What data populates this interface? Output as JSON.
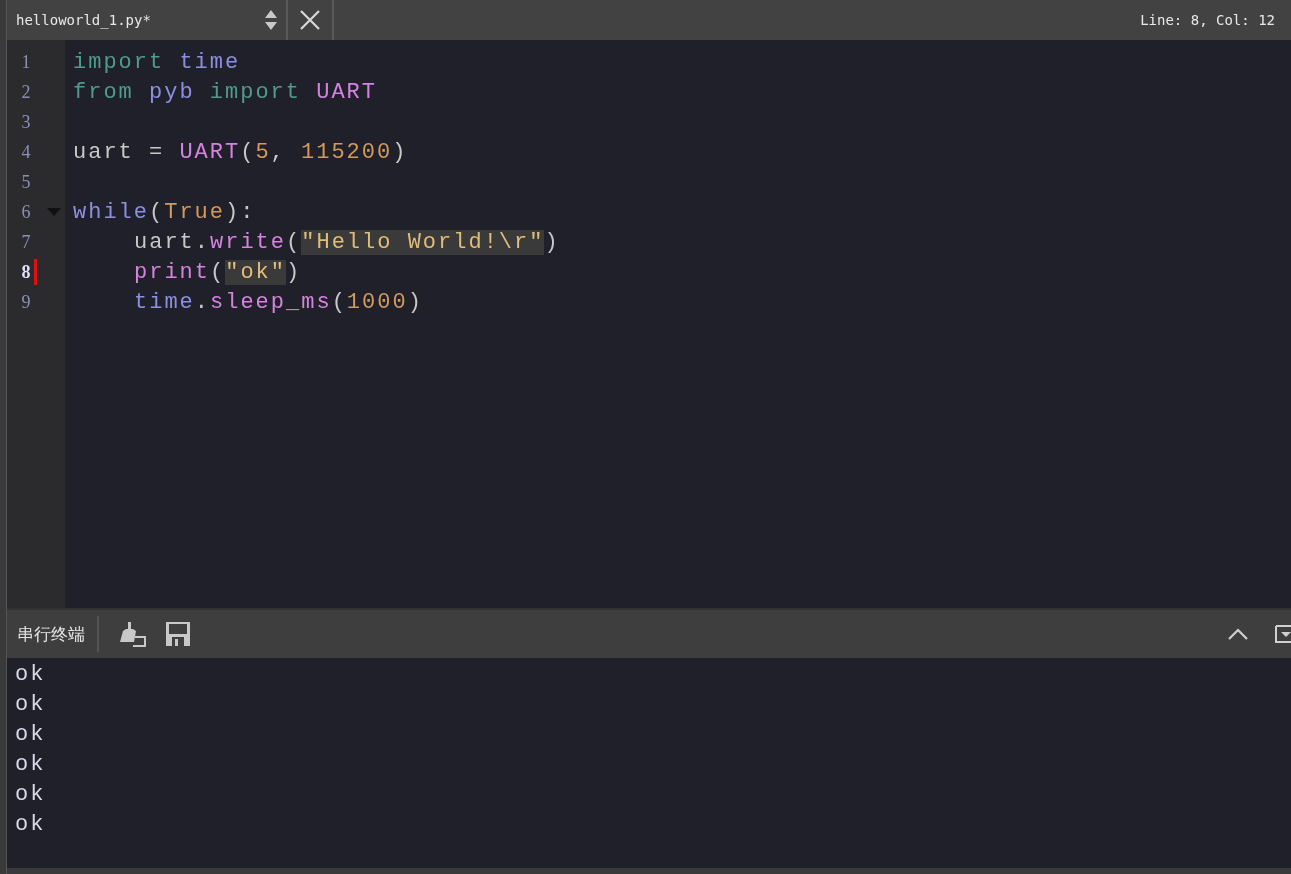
{
  "tab": {
    "filename": "helloworld_1.py*"
  },
  "status": "Line: 8, Col: 12",
  "editor": {
    "lines": [
      {
        "number": "1",
        "current": false,
        "changed": false,
        "fold": false,
        "tokens": [
          {
            "kind": "keyword",
            "text": "import",
            "gap": false
          },
          {
            "kind": "name",
            "text": "time",
            "gap": true
          }
        ]
      },
      {
        "number": "2",
        "current": false,
        "changed": false,
        "fold": false,
        "tokens": [
          {
            "kind": "keyword",
            "text": "from",
            "gap": false
          },
          {
            "kind": "name",
            "text": "pyb",
            "gap": true
          },
          {
            "kind": "keyword",
            "text": "import",
            "gap": true
          },
          {
            "kind": "call",
            "text": "UART",
            "gap": true
          }
        ]
      },
      {
        "number": "3",
        "current": false,
        "changed": false,
        "fold": false
      },
      {
        "number": "4",
        "current": false,
        "changed": false,
        "fold": false,
        "tokens": [
          {
            "kind": "plain",
            "text": "uart",
            "gap": false
          },
          {
            "kind": "plain",
            "text": "=",
            "gap": true
          },
          {
            "kind": "call",
            "text": "UART",
            "gap": true
          },
          {
            "kind": "plain",
            "text": "(",
            "gap": false
          },
          {
            "kind": "number",
            "text": "5",
            "gap": false
          },
          {
            "kind": "plain",
            "text": ",",
            "gap": false
          },
          {
            "kind": "number",
            "text": "115200",
            "gap": true
          },
          {
            "kind": "plain",
            "text": ")",
            "gap": false
          }
        ]
      },
      {
        "number": "5",
        "current": false,
        "changed": false,
        "fold": false
      },
      {
        "number": "6",
        "current": false,
        "changed": false,
        "fold": true,
        "tokens": [
          {
            "kind": "name",
            "text": "while",
            "gap": false
          },
          {
            "kind": "plain",
            "text": "(",
            "gap": false
          },
          {
            "kind": "constant",
            "text": "True",
            "gap": false
          },
          {
            "kind": "plain",
            "text": "):",
            "gap": false
          }
        ],
        "children": [
          {
            "number": "7",
            "current": false,
            "changed": false,
            "fold": false,
            "tokens": [
              {
                "kind": "plain",
                "text": "uart.",
                "gap": false
              },
              {
                "kind": "call",
                "text": "write",
                "gap": false
              },
              {
                "kind": "plain",
                "text": "(",
                "gap": false
              },
              {
                "kind": "string",
                "text": "\"Hello",
                "gap": false
              },
              {
                "kind": "string",
                "text": "World!\\r\"",
                "gap": true
              },
              {
                "kind": "plain",
                "text": ")",
                "gap": false
              }
            ]
          },
          {
            "number": "8",
            "current": true,
            "changed": true,
            "fold": false,
            "tokens": [
              {
                "kind": "call",
                "text": "print",
                "gap": false
              },
              {
                "kind": "plain",
                "text": "(",
                "gap": false
              },
              {
                "kind": "string",
                "text": "\"ok\"",
                "gap": false
              },
              {
                "kind": "plain",
                "text": ")",
                "gap": false
              }
            ]
          },
          {
            "number": "9",
            "current": false,
            "changed": false,
            "fold": false,
            "tokens": [
              {
                "kind": "name",
                "text": "time",
                "gap": false
              },
              {
                "kind": "plain",
                "text": ".",
                "gap": false
              },
              {
                "kind": "call",
                "text": "sleep_ms",
                "gap": false
              },
              {
                "kind": "plain",
                "text": "(",
                "gap": false
              },
              {
                "kind": "number",
                "text": "1000",
                "gap": false
              },
              {
                "kind": "plain",
                "text": ")",
                "gap": false
              }
            ]
          }
        ]
      }
    ]
  },
  "terminal": {
    "title": "串行终端",
    "output": [
      "ok",
      "ok",
      "ok",
      "ok",
      "ok",
      "ok"
    ]
  }
}
